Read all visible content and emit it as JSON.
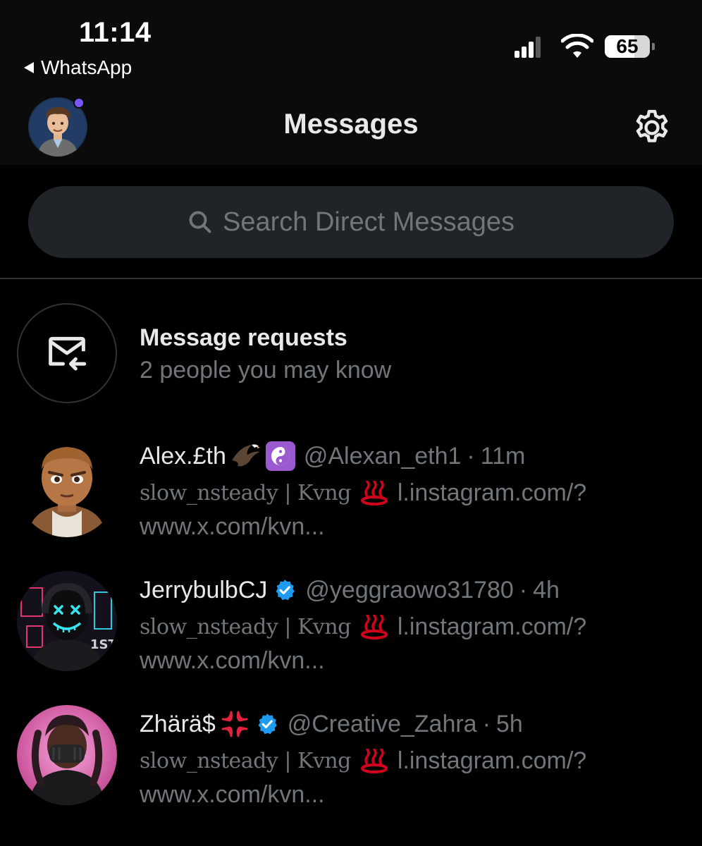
{
  "status_bar": {
    "time": "11:14",
    "back_app": "WhatsApp",
    "battery_level": "65",
    "battery_fraction": 0.65
  },
  "header": {
    "title": "Messages",
    "avatar_icon": "profile-avatar",
    "unread_dot_color": "#7856ff",
    "settings_icon": "gear-icon"
  },
  "search": {
    "placeholder": "Search Direct Messages",
    "icon": "search-icon"
  },
  "message_requests": {
    "title": "Message requests",
    "subtitle": "2 people you may know",
    "icon": "mail-incoming-icon"
  },
  "conversations": [
    {
      "name": "Alex.£th",
      "name_emojis": [
        "eagle",
        "yin-yang"
      ],
      "verified": false,
      "handle": "@Alexan_eth1",
      "separator": "·",
      "time": "11m",
      "preview_fancy": "slow_nsteady | Kvng",
      "preview_emoji": "hot-springs",
      "preview_link": "l.instagram.com/?",
      "preview_line2": "www.x.com/kvn..."
    },
    {
      "name": "JerrybulbCJ",
      "name_emojis": [],
      "verified": true,
      "handle": "@yeggraowo31780",
      "separator": "·",
      "time": "4h",
      "preview_fancy": "slow_nsteady | Kvng",
      "preview_emoji": "hot-springs",
      "preview_link": "l.instagram.com/?",
      "preview_line2": "www.x.com/kvn..."
    },
    {
      "name": "Zhärä$",
      "name_emojis": [
        "anger-symbol"
      ],
      "verified": true,
      "handle": "@Creative_Zahra",
      "separator": "·",
      "time": "5h",
      "preview_fancy": "slow_nsteady | Kvng",
      "preview_emoji": "hot-springs",
      "preview_link": "l.instagram.com/?",
      "preview_line2": "www.x.com/kvn..."
    }
  ],
  "colors": {
    "background": "#000000",
    "primary_text": "#e7e9ea",
    "secondary_text": "#71767b",
    "search_bg": "#202327",
    "verified_blue": "#1d9bf0",
    "hotsprings_red": "#d0021b"
  }
}
